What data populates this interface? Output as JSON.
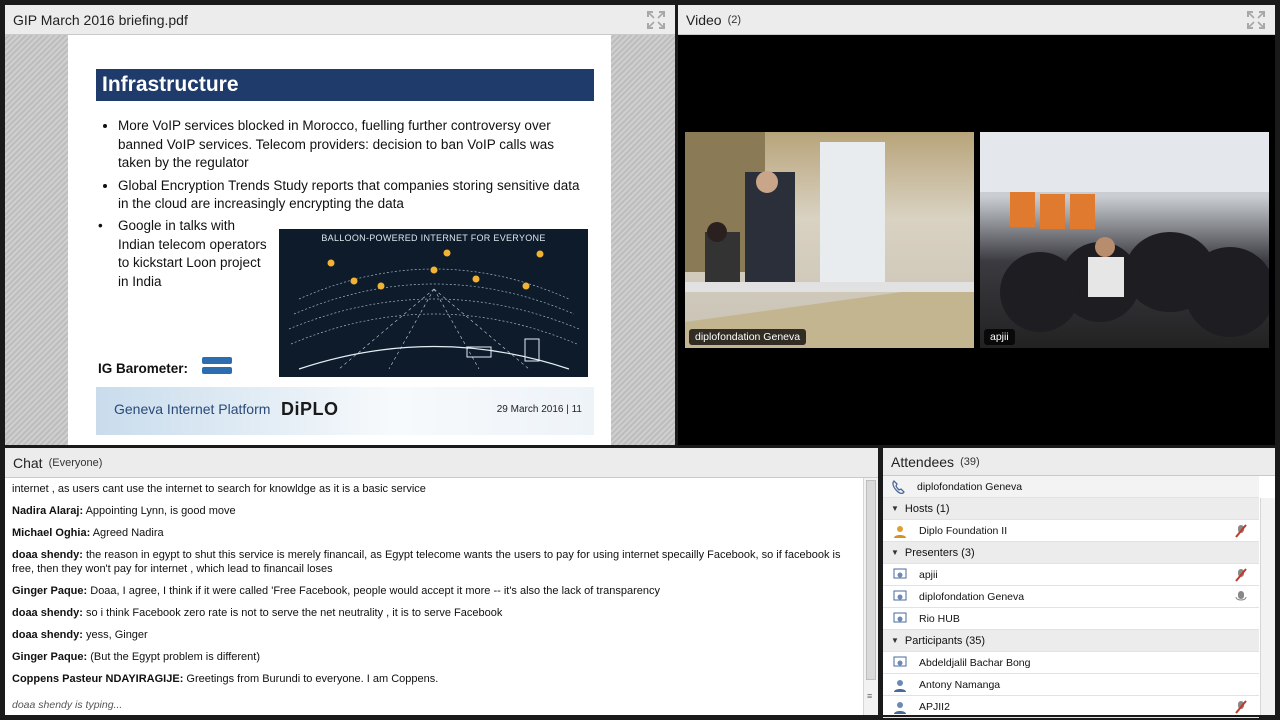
{
  "share": {
    "title": "GIP March 2016 briefing.pdf",
    "slide": {
      "title": "Infrastructure",
      "bullets": [
        "More VoIP services blocked in Morocco, fuelling further controversy over banned VoIP services. Telecom providers: decision to ban VoIP calls was taken by the regulator",
        "Global Encryption Trends Study reports that companies storing sensitive data in the cloud are increasingly encrypting the data"
      ],
      "bullet3": "Google in talks with Indian telecom operators to kickstart Loon project in India",
      "image_caption": "BALLOON-POWERED INTERNET FOR EVERYONE",
      "barometer_label": "IG Barometer:",
      "footer_left": "Geneva Internet Platform",
      "footer_logo": "DiPLO",
      "footer_date": "29 March 2016   |   11"
    }
  },
  "video": {
    "title": "Video",
    "count": "(2)",
    "feeds": [
      "diplofondation Geneva",
      "apjii"
    ]
  },
  "chat": {
    "title": "Chat",
    "scope": "(Everyone)",
    "messages": [
      {
        "sender": "",
        "text": "internet , as users cant use the internet to search for knowldge as it is a basic service"
      },
      {
        "sender": "Nadira Alaraj:",
        "text": " Appointing Lynn, is good move"
      },
      {
        "sender": "Michael Oghia:",
        "text": " Agreed Nadira"
      },
      {
        "sender": "doaa shendy:",
        "text": " the reason in egypt to shut this service is merely financail, as Egypt telecome wants the users to pay for using internet specailly Facebook, so if facebook is free, then they won't pay for internet , which lead to financail loses"
      },
      {
        "sender": "Ginger Paque:",
        "text": " Doaa, I agree, I think if it were called 'Free Facebook, people would accept it more -- it's also the lack of transparency"
      },
      {
        "sender": "doaa shendy:",
        "text": " so i think Facebook zero rate is not to serve the net neutrality , it is to serve Facebook"
      },
      {
        "sender": "doaa shendy:",
        "text": " yess, Ginger"
      },
      {
        "sender": "Ginger Paque:",
        "text": " (But the Egypt problem is different)"
      },
      {
        "sender": "Coppens Pasteur NDAYIRAGIJE:",
        "text": " Greetings from Burundi to everyone. I am Coppens."
      }
    ],
    "typing": "doaa shendy is typing..."
  },
  "attendees": {
    "title": "Attendees",
    "count": "(39)",
    "me": "diplofondation Geneva",
    "hosts_label": "Hosts (1)",
    "hosts": [
      "Diplo Foundation II"
    ],
    "presenters_label": "Presenters (3)",
    "presenters": [
      "apjii",
      "diplofondation Geneva",
      "Rio HUB"
    ],
    "participants_label": "Participants (35)",
    "participants": [
      "Abdeldjalil Bachar Bong",
      "Antony Namanga",
      "APJII2"
    ]
  },
  "colors": {
    "slide_title_bg": "#1f3b6b",
    "header_bg": "#ececec",
    "mic_red": "#c0392b"
  }
}
